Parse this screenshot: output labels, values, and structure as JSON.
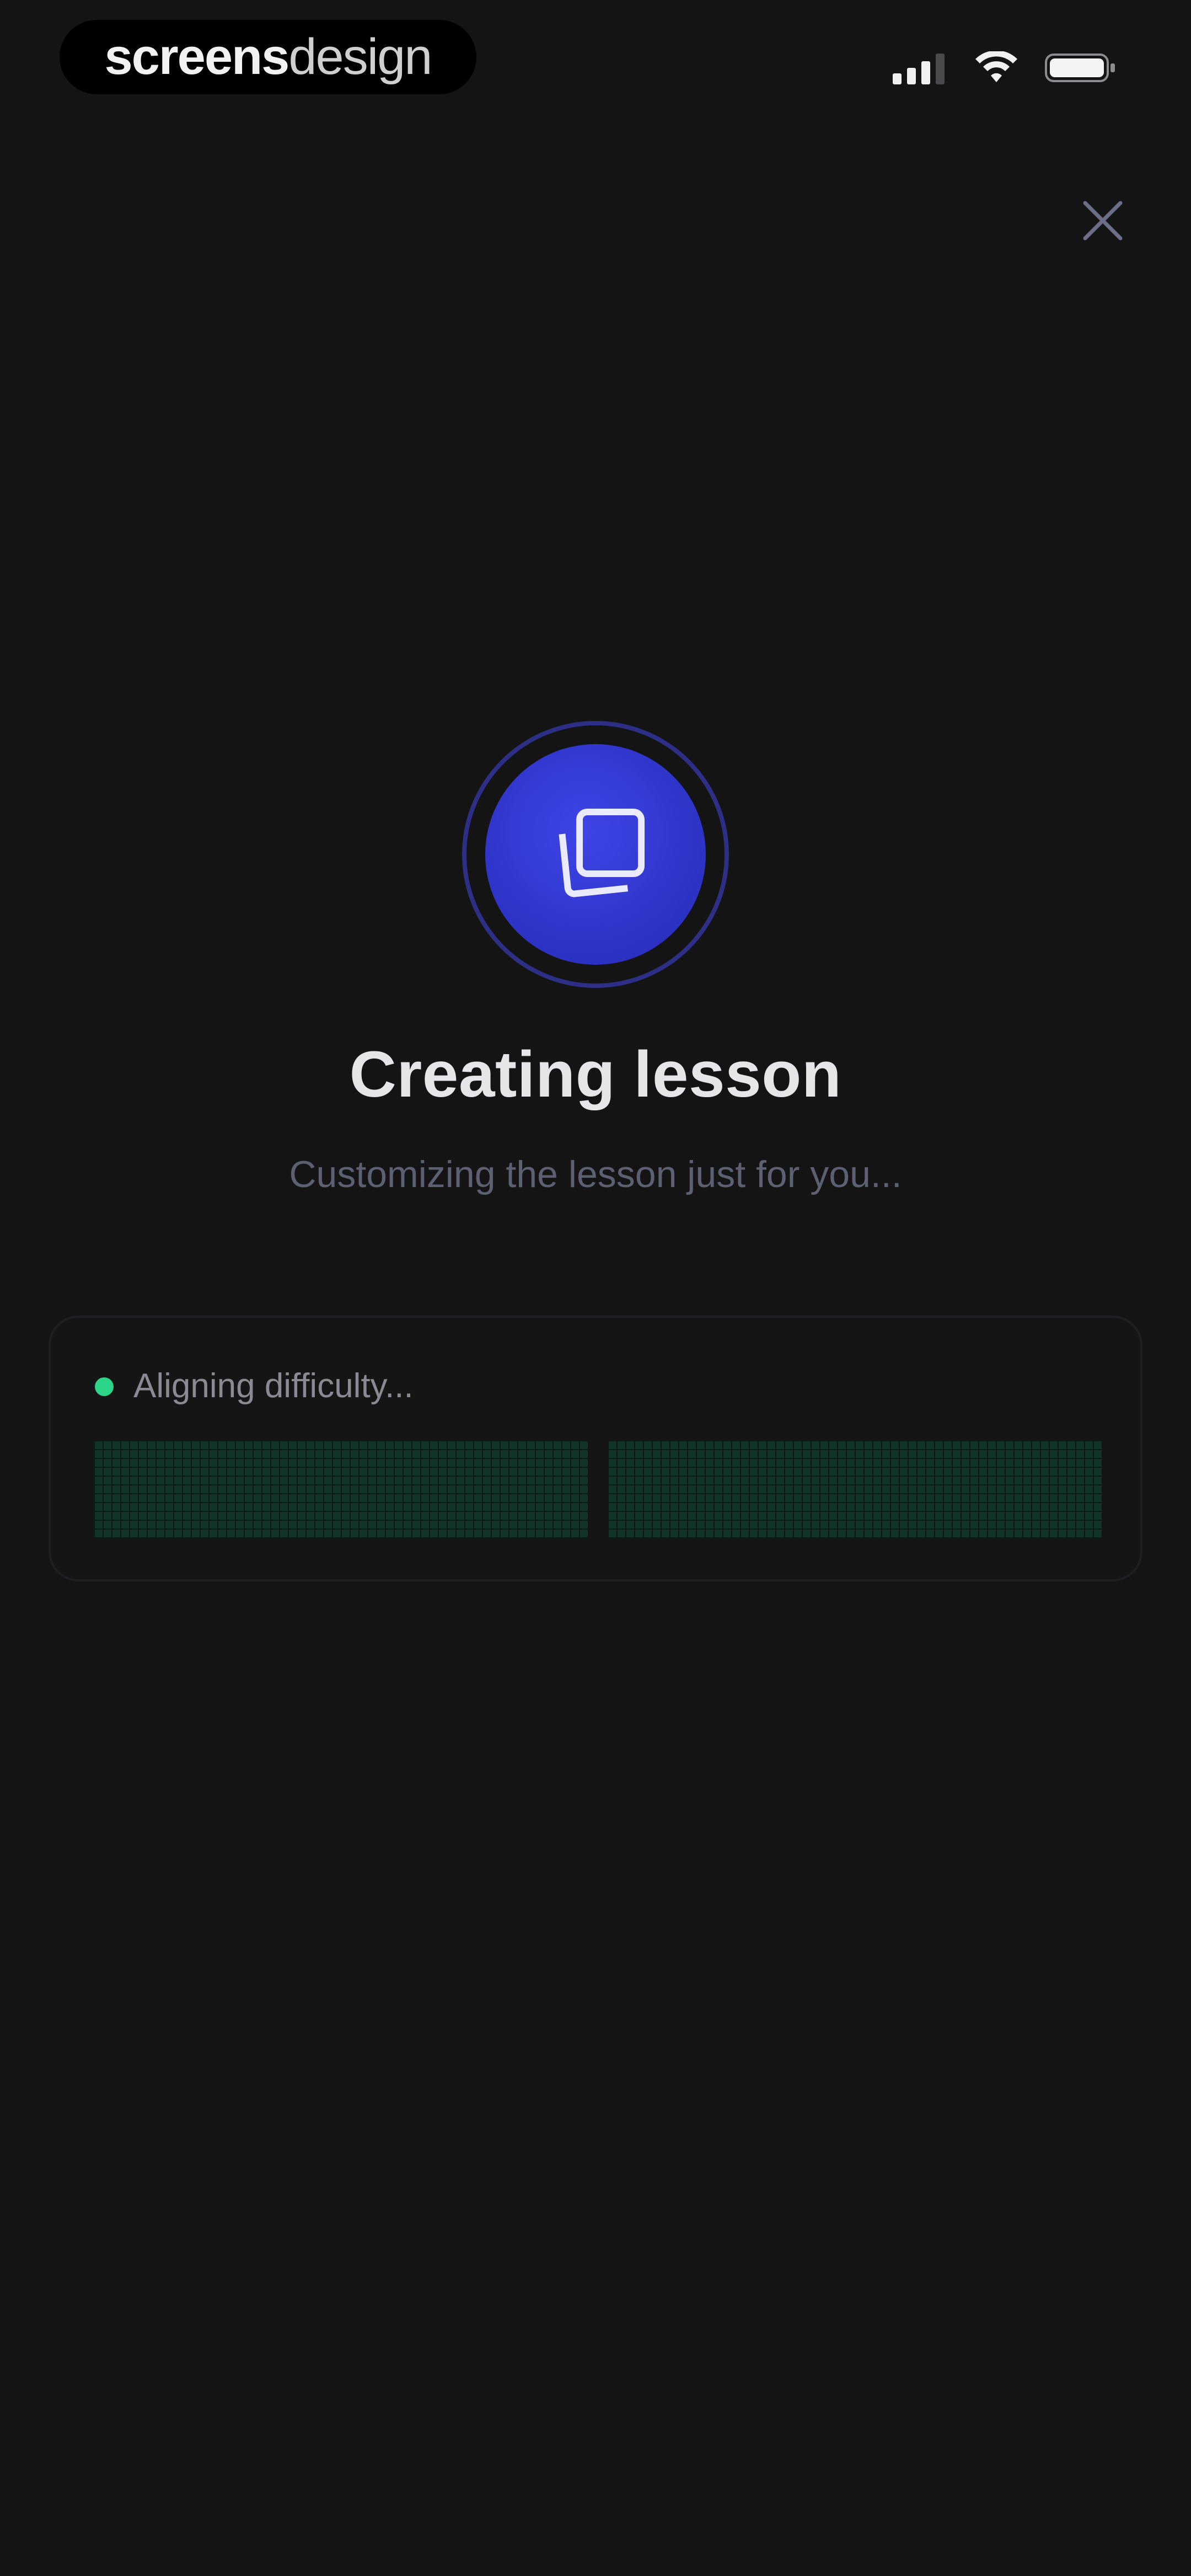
{
  "status_bar": {
    "brand_bold": "screens",
    "brand_light": "design",
    "icons": [
      "signal-icon",
      "wifi-icon",
      "battery-icon"
    ]
  },
  "header": {
    "close_icon": "close-icon"
  },
  "hero": {
    "icon": "stacked-cards-icon",
    "title": "Creating lesson",
    "subtitle": "Customizing the lesson just for you..."
  },
  "progress": {
    "step_label": "Aligning difficulty...",
    "step_status_color": "#2bd487",
    "panels": 2
  },
  "colors": {
    "background": "#141415",
    "accent": "#3139d6",
    "progress_green": "#123327"
  }
}
